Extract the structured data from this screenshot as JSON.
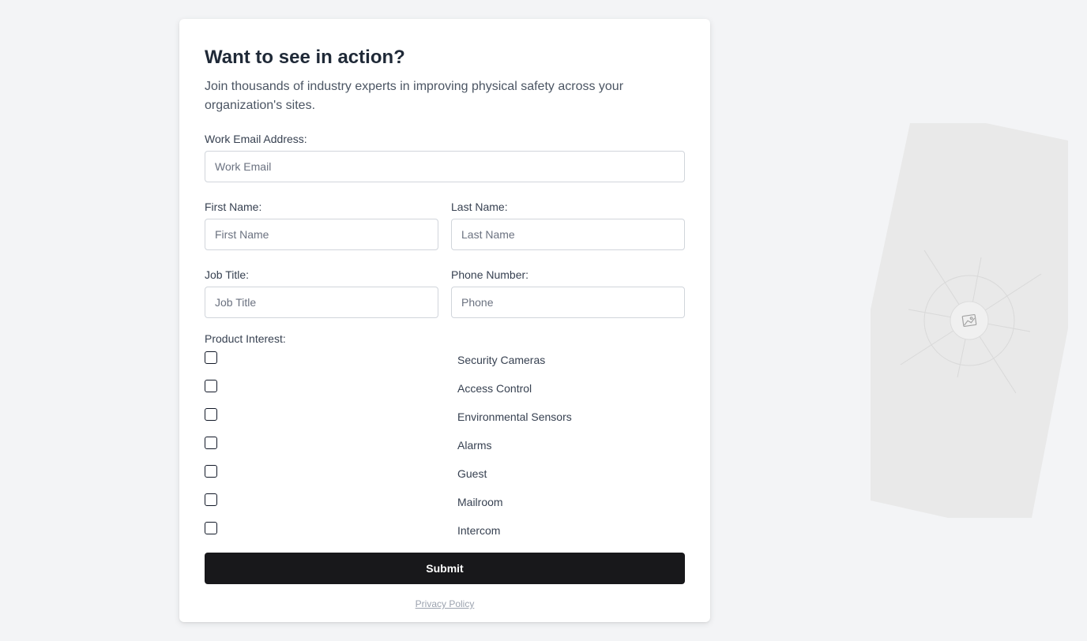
{
  "form": {
    "title": "Want to see in action?",
    "subtitle": "Join thousands of industry experts in improving physical safety across your organization's sites.",
    "email": {
      "label": "Work Email Address:",
      "placeholder": "Work Email",
      "value": ""
    },
    "first_name": {
      "label": "First Name:",
      "placeholder": "First Name",
      "value": ""
    },
    "last_name": {
      "label": "Last Name:",
      "placeholder": "Last Name",
      "value": ""
    },
    "job_title": {
      "label": "Job Title:",
      "placeholder": "Job Title",
      "value": ""
    },
    "phone": {
      "label": "Phone Number:",
      "placeholder": "Phone",
      "value": ""
    },
    "interest": {
      "label": "Product Interest:",
      "options": [
        {
          "label": "Security Cameras",
          "checked": false
        },
        {
          "label": "Access Control",
          "checked": false
        },
        {
          "label": "Environmental Sensors",
          "checked": false
        },
        {
          "label": "Alarms",
          "checked": false
        },
        {
          "label": "Guest",
          "checked": false
        },
        {
          "label": "Mailroom",
          "checked": false
        },
        {
          "label": "Intercom",
          "checked": false
        }
      ]
    },
    "submit_label": "Submit",
    "privacy_label": "Privacy Policy"
  },
  "decoration": {
    "icon": "image-placeholder-icon",
    "fill_color": "#e9e9e9"
  },
  "colors": {
    "background": "#f3f4f6",
    "card": "#ffffff",
    "button": "#18181b",
    "button_text": "#ffffff"
  }
}
